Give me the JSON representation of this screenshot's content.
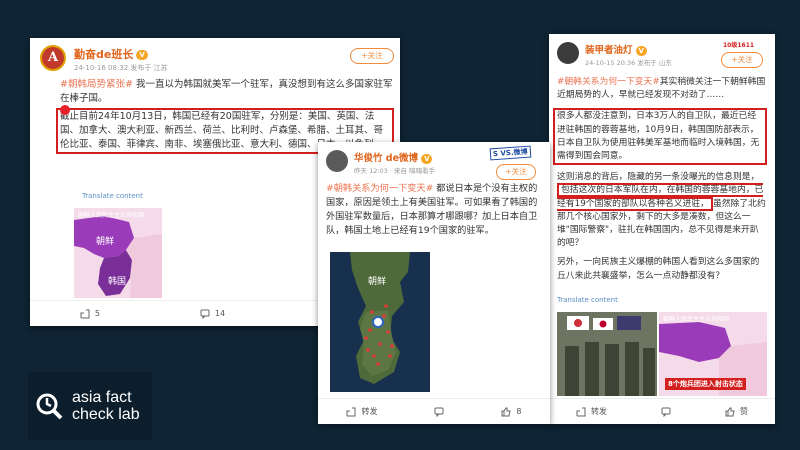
{
  "post1": {
    "username": "勤奋de班长",
    "badge": "V",
    "meta": "24-10-16 08:32 发布于 江苏",
    "follow": "+关注",
    "tag": "#朝韩局势紧张#",
    "text": " 我一直以为韩国就美军一个驻军，真没想到有这么多国家驻军在棒子国。",
    "highlight": "截止目前24年10月13日，韩国已经有20国驻军，分别是：美国、英国、法国、加拿大、澳大利亚、新西兰、荷兰、比利时、卢森堡、希腊、土耳其、哥伦比亚、泰国、菲律宾、南非、埃塞俄比亚、意大利、德国、日本、以色列",
    "translate": "Translate content",
    "map_caption": "朝鲜人民民主主义共和国",
    "map_label_north": "朝鲜",
    "map_label_south": "韩国",
    "repost_count": "5",
    "comment_count": "14",
    "like_count": "21"
  },
  "post2": {
    "username": "华俊竹 de微博",
    "badge": "V",
    "meta": "昨天 12:03 · 来自 嗨嗨看手",
    "follow": "+关注",
    "tag": "#朝韩关系为何一下变天#",
    "text": " 都说日本是个没有主权的国家，原因是领土上有美国驻军。可如果看了韩国的外国驻军数量后，日本那算才哪跟哪？加上日本自卫队，韩国土地上已经有19个国家的驻军。",
    "stamp": "S VS.微博",
    "map_label": "朝鲜",
    "repost_label": "转发",
    "like_count": "8"
  },
  "post3": {
    "username": "装甲者油灯",
    "badge": "V",
    "meta": "24-10-15 20:36 发布于 山东",
    "follow": "+关注",
    "corner_tag": "10级1611",
    "tag": "#朝韩关系为何一下变天#",
    "text": "其实稍微关注一下朝鲜韩国近期局势的人，早就已经发现不对劲了……",
    "highlight1": "很多人都没注意到，日本3万人的自卫队，最近已经进驻韩国的蓉蓉基地，10月9日，韩国国防部表示，日本自卫队为使用驻韩美军基地而临时入境韩国，无需得到国会同意。",
    "text2a": "这则消息的背后，隐藏的另一条没曝光的信息则是，",
    "highlight2": "包括这次的日本军队在内，在韩国的蓉蓉基地内，已经有19个国家的部队以各种名义进驻，",
    "text2b": "虽然除了北约那几个核心国家外，剩下的大多是凑数，但这么一堆\"国际警察\"，驻扎在韩国国内，总不见得是来开趴的吧？",
    "text3": "另外，一向民族主义爆棚的韩国人看到这么多国家的丘八来此共襄盛举，怎么一点动静都没有？",
    "translate": "Translate content",
    "img_caption": "朝鲜人民民主主义共和国",
    "ribbon": "8个炮兵团进入射击状态",
    "repost_label": "转发",
    "like_label": "赞"
  },
  "watermark": {
    "line1": "asia fact",
    "line2": "check lab"
  },
  "colors": {
    "background": "#0f2434",
    "accent_orange": "#eb7350",
    "highlight_red": "#d41f1f",
    "map_purple": "#8a3fb0"
  }
}
